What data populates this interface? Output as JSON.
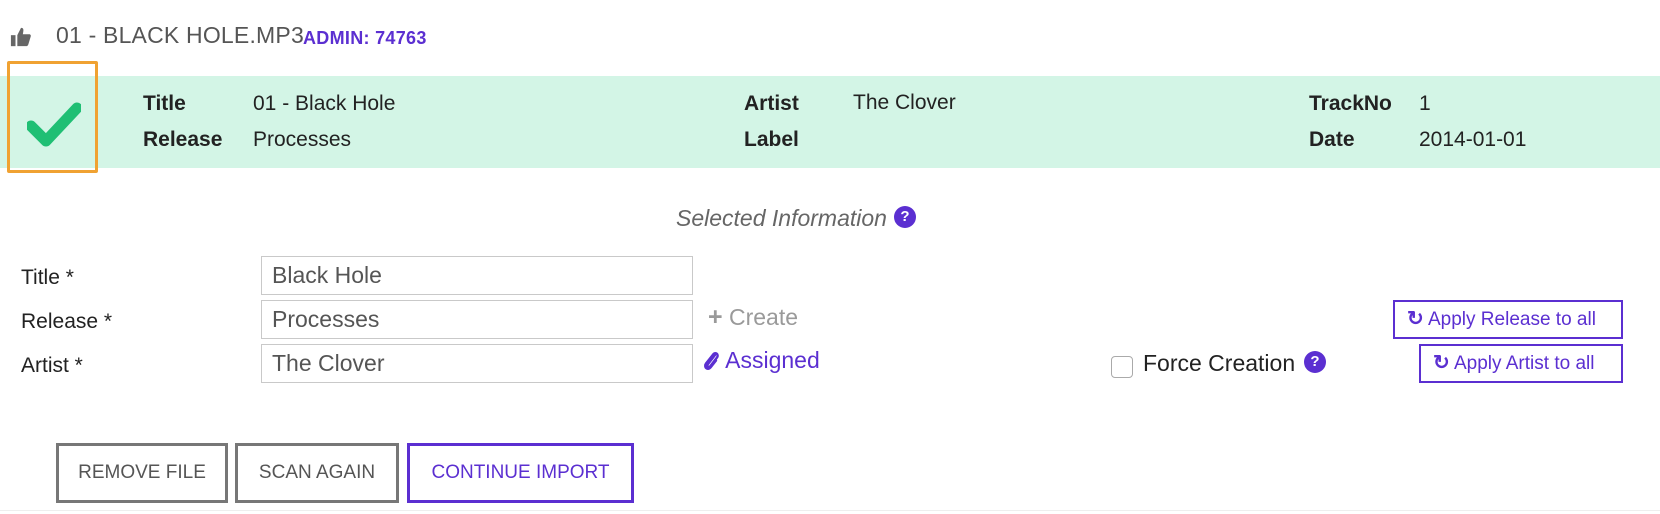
{
  "header": {
    "file_name": "01 - BLACK HOLE.MP3",
    "admin_label": "ADMIN: 74763",
    "status_icon": "thumbs-up-icon"
  },
  "track_info": {
    "status_icon": "checkmark-icon",
    "title_label": "Title",
    "title_value": "01 - Black Hole",
    "release_label": "Release",
    "release_value": "Processes",
    "artist_label": "Artist",
    "artist_value": "The Clover",
    "label_label": "Label",
    "label_value": "",
    "trackno_label": "TrackNo",
    "trackno_value": "1",
    "date_label": "Date",
    "date_value": "2014-01-01"
  },
  "selected": {
    "heading": "Selected Information",
    "help": "?"
  },
  "form": {
    "title_label": "Title *",
    "title_value": "Black Hole",
    "release_label": "Release *",
    "release_value": "Processes",
    "artist_label": "Artist *",
    "artist_value": "The Clover",
    "create_label": "Create",
    "assigned_label": "Assigned",
    "force_label": "Force Creation",
    "force_checked": false,
    "force_help": "?",
    "apply_release_label": "Apply Release to all",
    "apply_artist_label": "Apply Artist to all"
  },
  "actions": {
    "remove_label": "REMOVE FILE",
    "scan_label": "SCAN AGAIN",
    "continue_label": "CONTINUE IMPORT"
  },
  "colors": {
    "accent": "#5b2fd1",
    "band": "#d3f5e6",
    "check": "#1fbf74",
    "highlight_border": "#f0a232"
  }
}
